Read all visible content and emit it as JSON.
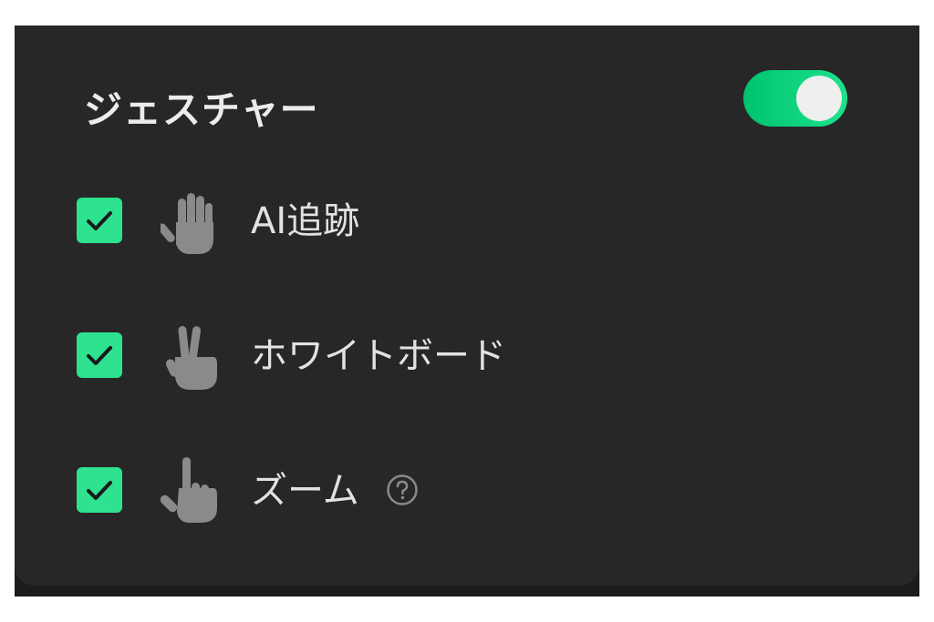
{
  "panel": {
    "title": "ジェスチャー",
    "toggle": {
      "on": true,
      "accent": "#1ee28c"
    }
  },
  "gestures": [
    {
      "label": "AI追跡",
      "checked": true,
      "icon": "open-hand-icon"
    },
    {
      "label": "ホワイトボード",
      "checked": true,
      "icon": "two-finger-hand-icon"
    },
    {
      "label": "ズーム",
      "checked": true,
      "icon": "pointing-hand-icon",
      "help_icon": "help-question-icon"
    }
  ],
  "colors": {
    "panel_bg": "#272727",
    "checkbox": "#2ee28f",
    "icon_gray": "#8a8a8a",
    "text": "#e2e2e2"
  }
}
